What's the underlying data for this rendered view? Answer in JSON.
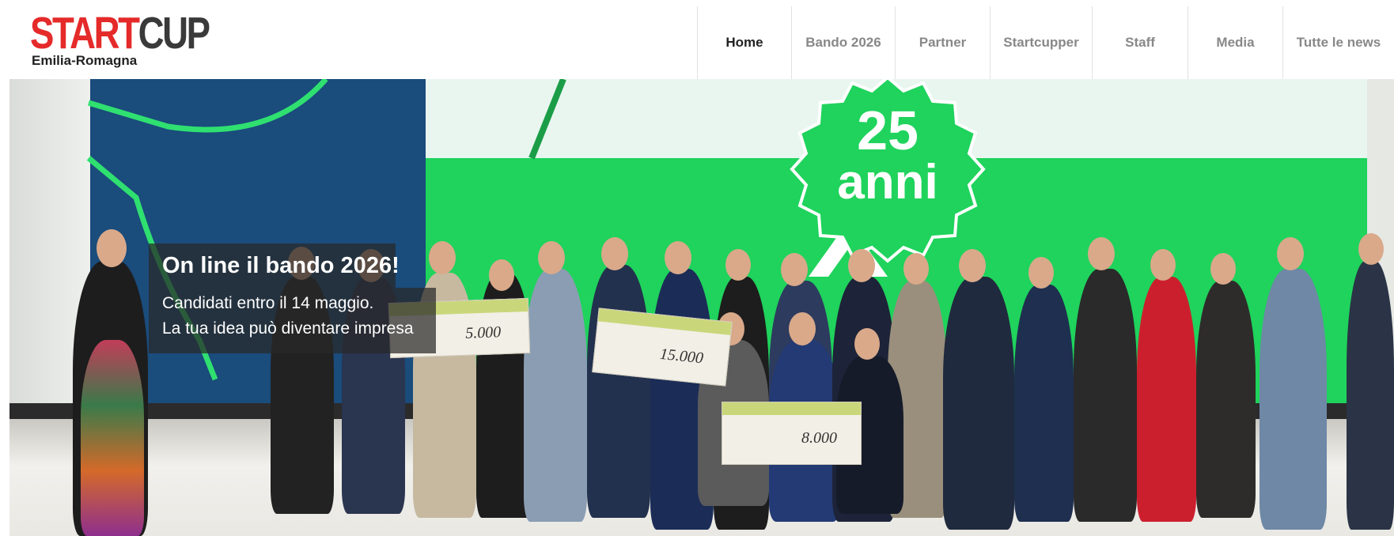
{
  "logo": {
    "main_start": "START",
    "main_cup": "CUP",
    "subtitle": "Emilia-Romagna"
  },
  "nav": {
    "items": [
      {
        "label": "Home"
      },
      {
        "label": "Bando 2026"
      },
      {
        "label": "Partner"
      },
      {
        "label": "Startcupper"
      },
      {
        "label": "Staff"
      },
      {
        "label": "Media"
      },
      {
        "label": "Tutte le news"
      }
    ],
    "active_index": 0
  },
  "hero": {
    "badge_number": "25",
    "badge_word": "anni",
    "caption_title": "On line il bando 2026!",
    "caption_line1": "Candidati entro il 14 maggio.",
    "caption_line2": "La tua idea può diventare impresa",
    "check_amounts": [
      "15.000",
      "8.000",
      "5.000"
    ],
    "colors": {
      "screen_green": "#1fd35c",
      "screen_blue": "#1a4c7c",
      "brand_red": "#e52a2a"
    }
  }
}
